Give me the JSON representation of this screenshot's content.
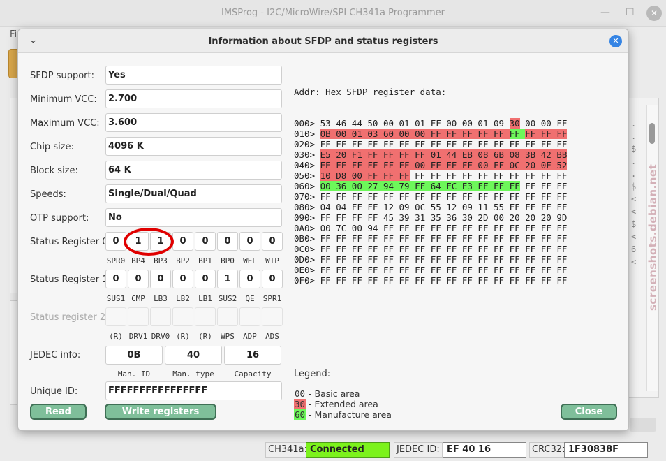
{
  "main_window": {
    "title": "IMSProg - I2C/MicroWire/SPI CH341a Programmer",
    "menu_fragment": "Fi",
    "minimize_glyph": "—",
    "maximize_glyph": "☐",
    "close_glyph": "✕",
    "side_glyphs": [
      ".",
      ".",
      "$",
      ".",
      ".",
      "$",
      "<",
      "<",
      "$",
      "<",
      "6",
      "<"
    ]
  },
  "watermark": "screenshots.debian.net",
  "status_bar": {
    "ch341a_label": "CH341a:",
    "connection": "Connected",
    "jedec_label": "JEDEC ID:",
    "jedec_value": "EF 40 16",
    "crc_label": "CRC32:",
    "crc_value": "1F30838F"
  },
  "dialog": {
    "title": "Information about SFDP and status registers",
    "menu_glyph": "⌄",
    "close_glyph": "✕",
    "fields": [
      {
        "label": "SFDP support:",
        "value": "Yes"
      },
      {
        "label": "Minimum VCC:",
        "value": "2.700"
      },
      {
        "label": "Maximum VCC:",
        "value": "3.600"
      },
      {
        "label": "Chip size:",
        "value": "4096 K"
      },
      {
        "label": "Block size:",
        "value": "64 K"
      },
      {
        "label": "Speeds:",
        "value": "Single/Dual/Quad"
      },
      {
        "label": "OTP support:",
        "value": "No"
      }
    ],
    "status_registers": [
      {
        "label": "Status Register 0",
        "bits": [
          "0",
          "1",
          "1",
          "0",
          "0",
          "0",
          "0",
          "0"
        ],
        "bit_names": [
          "SPR0",
          "BP4",
          "BP3",
          "BP2",
          "BP1",
          "BP0",
          "WEL",
          "WIP"
        ]
      },
      {
        "label": "Status Register 1",
        "bits": [
          "0",
          "0",
          "0",
          "0",
          "0",
          "1",
          "0",
          "0"
        ],
        "bit_names": [
          "SUS1",
          "CMP",
          "LB3",
          "LB2",
          "LB1",
          "SUS2",
          "QE",
          "SPR1"
        ]
      },
      {
        "label": "Status register 2",
        "bits": [
          "",
          "",
          "",
          "",
          "",
          "",
          "",
          ""
        ],
        "bit_names": [
          "(R)",
          "DRV1",
          "DRV0",
          "(R)",
          "(R)",
          "WPS",
          "ADP",
          "ADS"
        ]
      }
    ],
    "jedec": {
      "label": "JEDEC info:",
      "values": [
        "0B",
        "40",
        "16"
      ],
      "captions": [
        "Man. ID",
        "Man. type",
        "Capacity"
      ]
    },
    "unique_id": {
      "label": "Unique ID:",
      "value": "FFFFFFFFFFFFFFFF"
    },
    "buttons": {
      "read": "Read",
      "write": "Write registers",
      "close": "Close"
    },
    "hex": {
      "header": "Addr: Hex SFDP register data:",
      "rows": [
        {
          "addr": "000>",
          "bytes": [
            "53",
            "46",
            "44",
            "50",
            "00",
            "01",
            "01",
            "FF",
            "00",
            "00",
            "01",
            "09",
            "30",
            "00",
            "00",
            "FF"
          ]
        },
        {
          "addr": "010>",
          "bytes": [
            "0B",
            "00",
            "01",
            "03",
            "60",
            "00",
            "00",
            "FF",
            "FF",
            "FF",
            "FF",
            "FF",
            "FF",
            "FF",
            "FF",
            "FF"
          ]
        },
        {
          "addr": "020>",
          "bytes": [
            "FF",
            "FF",
            "FF",
            "FF",
            "FF",
            "FF",
            "FF",
            "FF",
            "FF",
            "FF",
            "FF",
            "FF",
            "FF",
            "FF",
            "FF",
            "FF"
          ]
        },
        {
          "addr": "030>",
          "bytes": [
            "E5",
            "20",
            "F1",
            "FF",
            "FF",
            "FF",
            "FF",
            "01",
            "44",
            "EB",
            "08",
            "6B",
            "08",
            "3B",
            "42",
            "BB"
          ]
        },
        {
          "addr": "040>",
          "bytes": [
            "EE",
            "FF",
            "FF",
            "FF",
            "FF",
            "FF",
            "00",
            "FF",
            "FF",
            "FF",
            "00",
            "FF",
            "0C",
            "20",
            "0F",
            "52"
          ]
        },
        {
          "addr": "050>",
          "bytes": [
            "10",
            "D8",
            "00",
            "FF",
            "FF",
            "FF",
            "FF",
            "FF",
            "FF",
            "FF",
            "FF",
            "FF",
            "FF",
            "FF",
            "FF",
            "FF"
          ]
        },
        {
          "addr": "060>",
          "bytes": [
            "00",
            "36",
            "00",
            "27",
            "94",
            "79",
            "FF",
            "64",
            "FC",
            "E3",
            "FF",
            "FF",
            "FF",
            "FF",
            "FF",
            "FF"
          ]
        },
        {
          "addr": "070>",
          "bytes": [
            "FF",
            "FF",
            "FF",
            "FF",
            "FF",
            "FF",
            "FF",
            "FF",
            "FF",
            "FF",
            "FF",
            "FF",
            "FF",
            "FF",
            "FF",
            "FF"
          ]
        },
        {
          "addr": "080>",
          "bytes": [
            "04",
            "04",
            "FF",
            "FF",
            "12",
            "09",
            "0C",
            "55",
            "12",
            "09",
            "11",
            "55",
            "FF",
            "FF",
            "FF",
            "FF"
          ]
        },
        {
          "addr": "090>",
          "bytes": [
            "FF",
            "FF",
            "FF",
            "FF",
            "45",
            "39",
            "31",
            "35",
            "36",
            "30",
            "2D",
            "00",
            "20",
            "20",
            "20",
            "9D"
          ]
        },
        {
          "addr": "0A0>",
          "bytes": [
            "00",
            "7C",
            "00",
            "94",
            "FF",
            "FF",
            "FF",
            "FF",
            "FF",
            "FF",
            "FF",
            "FF",
            "FF",
            "FF",
            "FF",
            "FF"
          ]
        },
        {
          "addr": "0B0>",
          "bytes": [
            "FF",
            "FF",
            "FF",
            "FF",
            "FF",
            "FF",
            "FF",
            "FF",
            "FF",
            "FF",
            "FF",
            "FF",
            "FF",
            "FF",
            "FF",
            "FF"
          ]
        },
        {
          "addr": "0C0>",
          "bytes": [
            "FF",
            "FF",
            "FF",
            "FF",
            "FF",
            "FF",
            "FF",
            "FF",
            "FF",
            "FF",
            "FF",
            "FF",
            "FF",
            "FF",
            "FF",
            "FF"
          ]
        },
        {
          "addr": "0D0>",
          "bytes": [
            "FF",
            "FF",
            "FF",
            "FF",
            "FF",
            "FF",
            "FF",
            "FF",
            "FF",
            "FF",
            "FF",
            "FF",
            "FF",
            "FF",
            "FF",
            "FF"
          ]
        },
        {
          "addr": "0E0>",
          "bytes": [
            "FF",
            "FF",
            "FF",
            "FF",
            "FF",
            "FF",
            "FF",
            "FF",
            "FF",
            "FF",
            "FF",
            "FF",
            "FF",
            "FF",
            "FF",
            "FF"
          ]
        },
        {
          "addr": "0F0>",
          "bytes": [
            "FF",
            "FF",
            "FF",
            "FF",
            "FF",
            "FF",
            "FF",
            "FF",
            "FF",
            "FF",
            "FF",
            "FF",
            "FF",
            "FF",
            "FF",
            "FF"
          ]
        }
      ],
      "highlight": {
        "red": [
          [
            0,
            12
          ],
          [
            1,
            0,
            1,
            2,
            3,
            4,
            5,
            6,
            7,
            8,
            9,
            10,
            11,
            12,
            13,
            14,
            15
          ],
          [
            3,
            0,
            1,
            2,
            3,
            4,
            5,
            6,
            7,
            8,
            9,
            10,
            11,
            12,
            13,
            14,
            15
          ],
          [
            4,
            0,
            1,
            2,
            3,
            4,
            5,
            6,
            7,
            8,
            9,
            10,
            11,
            12,
            13,
            14,
            15
          ],
          [
            5,
            0,
            1,
            2,
            3,
            4,
            5
          ]
        ],
        "green": [
          [
            1,
            12
          ],
          [
            6,
            0,
            1,
            2,
            3,
            4,
            5,
            6,
            7,
            8,
            9,
            10,
            11,
            12
          ]
        ]
      }
    },
    "legend": {
      "title": "Legend:",
      "items": [
        {
          "code": "00",
          "text": " - Basic area",
          "color": "none"
        },
        {
          "code": "30",
          "text": " - Extended area",
          "color": "#f07070"
        },
        {
          "code": "60",
          "text": " - Manufacture area",
          "color": "#6df75a"
        }
      ]
    }
  }
}
